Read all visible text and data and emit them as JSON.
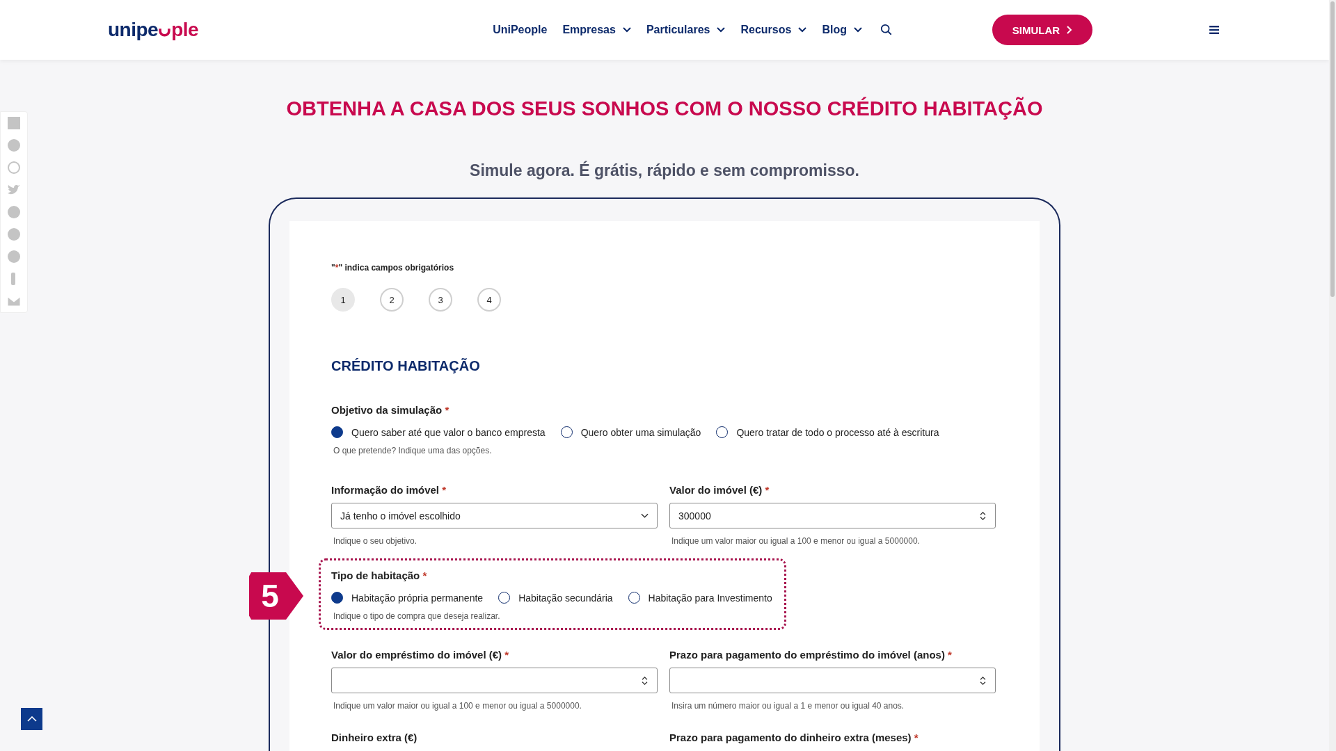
{
  "header": {
    "logo": {
      "part_1": "unipe",
      "part_2": "ple"
    },
    "nav": [
      {
        "label": "UniPeople",
        "dropdown": false
      },
      {
        "label": "Empresas",
        "dropdown": true
      },
      {
        "label": "Particulares",
        "dropdown": true
      },
      {
        "label": "Recursos",
        "dropdown": true
      },
      {
        "label": "Blog",
        "dropdown": true
      }
    ],
    "cta": "SIMULAR"
  },
  "hero": {
    "title": "OBTENHA A CASA DOS SEUS SONHOS COM O NOSSO CRÉDITO HABITAÇÃO",
    "subtitle": "Simule agora. É grátis, rápido e sem compromisso."
  },
  "form": {
    "required_note": {
      "quote": "\"",
      "mark": "*",
      "text": "\" indica campos obrigatórios"
    },
    "steps": [
      {
        "label": "1",
        "selected": true
      },
      {
        "label": "2",
        "selected": false
      },
      {
        "label": "3",
        "selected": false
      },
      {
        "label": "4",
        "selected": false
      }
    ],
    "section_title": "CRÉDITO HABITAÇÃO",
    "objective": {
      "label": "Objetivo da simulação",
      "required": true,
      "options": [
        {
          "label": "Quero saber até que valor o banco empresta",
          "selected": true
        },
        {
          "label": "Quero obter uma simulação",
          "selected": false
        },
        {
          "label": "Quero tratar de todo o processo até à escritura",
          "selected": false
        }
      ],
      "help": "O que pretende? Indique uma das opções."
    },
    "row_1": [
      {
        "kind": "select",
        "label": "Informação do imóvel",
        "required": true,
        "value": "Já tenho o imóvel escolhido",
        "help": "Indique o seu objetivo."
      },
      {
        "kind": "number",
        "label": "Valor do imóvel (€)",
        "required": true,
        "value": "300000",
        "help": "Indique um valor maior ou igual a 100 e menor ou igual a 5000000."
      }
    ],
    "housing_type": {
      "badge": "5",
      "label": "Tipo de habitação",
      "required": true,
      "options": [
        {
          "label": "Habitação própria permanente",
          "selected": true
        },
        {
          "label": "Habitação secundária",
          "selected": false
        },
        {
          "label": "Habitação para Investimento",
          "selected": false
        }
      ],
      "help": "Indique o tipo de compra que deseja realizar."
    },
    "row_2": [
      {
        "kind": "number",
        "label": "Valor do empréstimo do imóvel (€)",
        "required": true,
        "help": "Indique um valor maior ou igual a 100 e menor ou igual a 5000000."
      },
      {
        "kind": "number",
        "label": "Prazo para pagamento do empréstimo do imóvel (anos)",
        "required": true,
        "help": "Insira um número maior ou igual a 1 e menor ou igual 40 anos."
      }
    ],
    "row_3": [
      {
        "label": "Dinheiro extra (€)",
        "required": false
      },
      {
        "label": "Prazo para pagamento do dinheiro extra (meses)",
        "required": true
      }
    ]
  }
}
